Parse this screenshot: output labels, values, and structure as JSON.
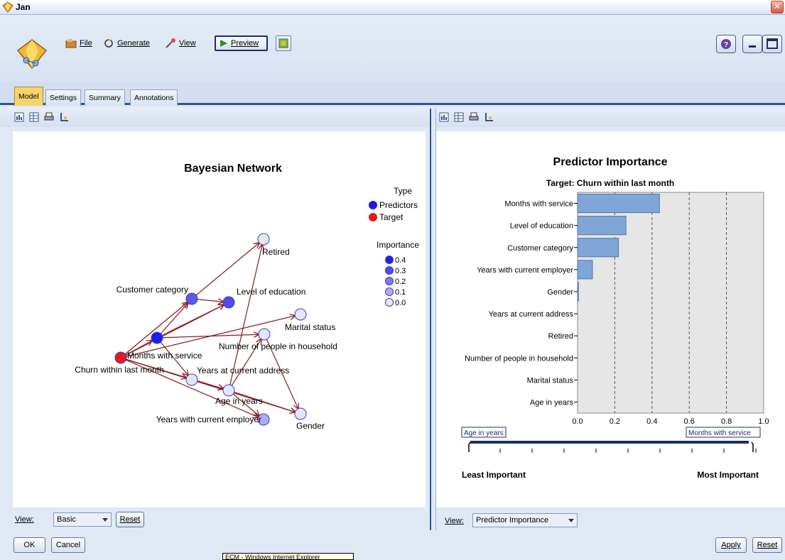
{
  "window": {
    "title": "Jan"
  },
  "toolbar": {
    "file_label": "File",
    "generate_label": "Generate",
    "view_label": "View",
    "preview_label": "Preview"
  },
  "tabs": [
    {
      "label": "Model",
      "active": true
    },
    {
      "label": "Settings",
      "active": false
    },
    {
      "label": "Summary",
      "active": false
    },
    {
      "label": "Annotations",
      "active": false
    }
  ],
  "left_panel": {
    "network": {
      "title": "Bayesian Network",
      "legend": {
        "type_heading": "Type",
        "types": [
          {
            "label": "Predictors",
            "color": "#1a1ae6"
          },
          {
            "label": "Target",
            "color": "#e61a1a"
          }
        ],
        "importance_heading": "Importance",
        "importance_levels": [
          {
            "label": "0.4",
            "color": "#1f1fe6"
          },
          {
            "label": "0.3",
            "color": "#4d4de8"
          },
          {
            "label": "0.2",
            "color": "#7d7de8"
          },
          {
            "label": "0.1",
            "color": "#adadee"
          },
          {
            "label": "0.0",
            "color": "#e6e6fb"
          }
        ]
      },
      "nodes": [
        {
          "id": "churn",
          "label": "Churn within last month",
          "color": "#e61a1a"
        },
        {
          "id": "months",
          "label": "Months with service",
          "color": "#1f1fe6"
        },
        {
          "id": "category",
          "label": "Customer category",
          "color": "#5a5ae6"
        },
        {
          "id": "education",
          "label": "Level of education",
          "color": "#4d4de8"
        },
        {
          "id": "retired",
          "label": "Retired",
          "color": "#e6e6fb"
        },
        {
          "id": "marital",
          "label": "Marital status",
          "color": "#e6e6fb"
        },
        {
          "id": "household",
          "label": "Number of people in household",
          "color": "#e6e6fb"
        },
        {
          "id": "address",
          "label": "Years at current address",
          "color": "#e6e6fb"
        },
        {
          "id": "age",
          "label": "Age in years",
          "color": "#e6e6fb"
        },
        {
          "id": "employer",
          "label": "Years with current employer",
          "color": "#adadee"
        },
        {
          "id": "gender",
          "label": "Gender",
          "color": "#e6e6fb"
        }
      ],
      "edges": [
        [
          "churn",
          "months"
        ],
        [
          "churn",
          "category"
        ],
        [
          "churn",
          "education"
        ],
        [
          "churn",
          "address"
        ],
        [
          "churn",
          "age"
        ],
        [
          "churn",
          "gender"
        ],
        [
          "churn",
          "employer"
        ],
        [
          "churn",
          "marital"
        ],
        [
          "months",
          "category"
        ],
        [
          "months",
          "education"
        ],
        [
          "months",
          "household"
        ],
        [
          "months",
          "address"
        ],
        [
          "category",
          "retired"
        ],
        [
          "category",
          "education"
        ],
        [
          "age",
          "retired"
        ],
        [
          "age",
          "household"
        ],
        [
          "age",
          "employer"
        ],
        [
          "age",
          "gender"
        ],
        [
          "household",
          "gender"
        ],
        [
          "address",
          "age"
        ]
      ]
    },
    "view_label": "View:",
    "view_value": "Basic",
    "reset_label": "Reset"
  },
  "right_panel": {
    "view_label": "View:",
    "view_value": "Predictor Importance",
    "slider": {
      "left_label": "Age in years",
      "right_label": "Months with service",
      "least_label": "Least Important",
      "most_label": "Most Important"
    }
  },
  "chart_data": {
    "type": "bar",
    "orientation": "horizontal",
    "title": "Predictor Importance",
    "subtitle": "Target: Churn within last month",
    "categories": [
      "Months with service",
      "Level of education",
      "Customer category",
      "Years with current employer",
      "Gender",
      "Years at current address",
      "Retired",
      "Number of people in household",
      "Marital status",
      "Age in years"
    ],
    "values": [
      0.44,
      0.26,
      0.22,
      0.08,
      0.005,
      0.0,
      0.0,
      0.0,
      0.0,
      0.0
    ],
    "xlim": [
      0.0,
      1.0
    ],
    "xticks": [
      "0.0",
      "0.2",
      "0.4",
      "0.6",
      "0.8",
      "1.0"
    ],
    "grid": "vertical dashed",
    "bar_color": "#7fa6d6"
  },
  "footer": {
    "ok_label": "OK",
    "cancel_label": "Cancel",
    "apply_label": "Apply",
    "reset_label": "Reset",
    "taskbar_tooltip": "ECM - Windows Internet Explorer"
  }
}
